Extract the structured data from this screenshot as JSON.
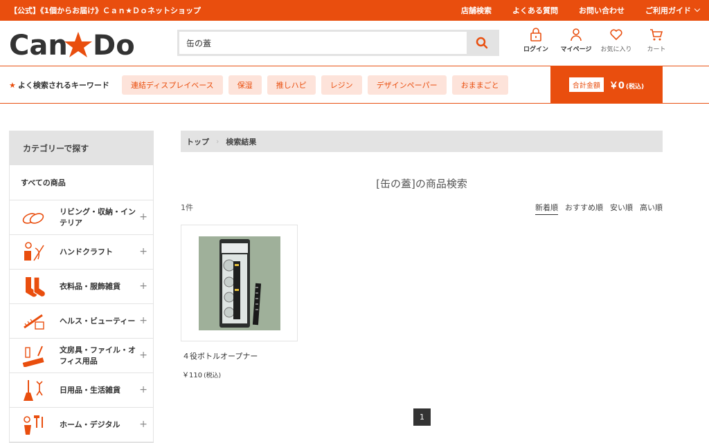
{
  "topbar": {
    "tagline": "【公式】《1個からお届け》Ｃａｎ★Ｄｏネットショップ",
    "links": [
      "店舗検索",
      "よくある質問",
      "お問い合わせ",
      "ご利用ガイド"
    ]
  },
  "header": {
    "logo_text": "Can★Do",
    "search_value": "缶の蓋",
    "icons": [
      {
        "label": "ログイン",
        "icon": "lock-icon"
      },
      {
        "label": "マイページ",
        "icon": "user-icon"
      },
      {
        "label": "お気に入り",
        "icon": "heart-icon"
      },
      {
        "label": "カート",
        "icon": "cart-icon"
      }
    ]
  },
  "keywords": {
    "title": "よく検索されるキーワード",
    "items": [
      "連結ディスプレイベース",
      "保湿",
      "推しハピ",
      "レジン",
      "デザインペーパー",
      "おままごと"
    ]
  },
  "cart_total": {
    "label": "合計金額",
    "value": "￥0",
    "tax": "(税込)"
  },
  "sidebar": {
    "heading": "カテゴリーで探す",
    "all_label": "すべての商品",
    "categories": [
      {
        "label": "リビング・収納・インテリア",
        "icon": "slippers-icon"
      },
      {
        "label": "ハンドクラフト",
        "icon": "craft-icon"
      },
      {
        "label": "衣料品・服飾雑貨",
        "icon": "socks-icon"
      },
      {
        "label": "ヘルス・ビューティー",
        "icon": "comb-icon"
      },
      {
        "label": "文房具・ファイル・オフィス用品",
        "icon": "stationery-icon"
      },
      {
        "label": "日用品・生活雑貨",
        "icon": "broom-icon"
      },
      {
        "label": "ホーム・デジタル",
        "icon": "tools-icon"
      }
    ]
  },
  "breadcrumb": [
    "トップ",
    "検索結果"
  ],
  "results": {
    "title": "[缶の蓋]の商品検索",
    "count": "1件",
    "sort_options": [
      "新着順",
      "おすすめ順",
      "安い順",
      "高い順"
    ],
    "active_sort": "新着順"
  },
  "products": [
    {
      "name": "４役ボトルオープナー",
      "price": "￥110",
      "tax": "(税込)"
    }
  ],
  "pagination": {
    "current": "1"
  },
  "colors": {
    "brand": "#e94e0e",
    "keyword_bg": "#fde3da",
    "gray": "#e3e3e3"
  }
}
